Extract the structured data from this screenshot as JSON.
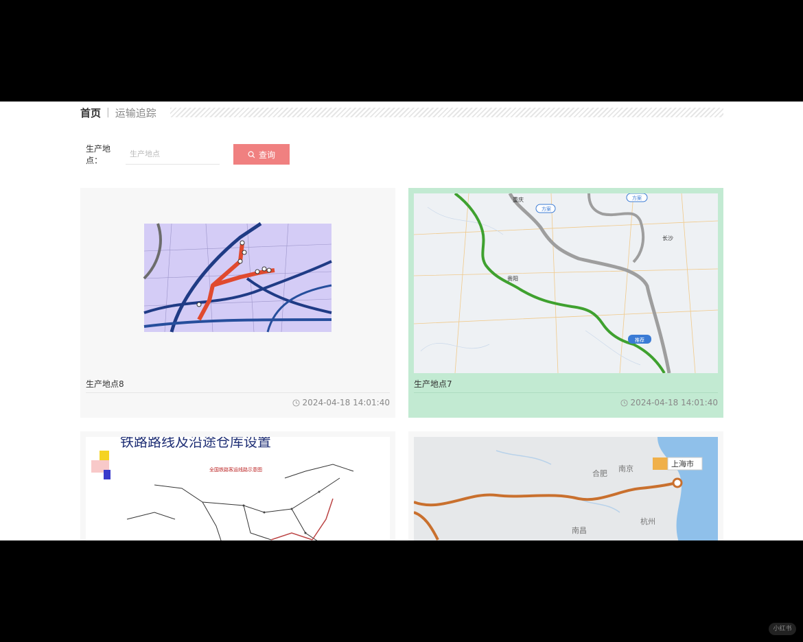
{
  "breadcrumb": {
    "home": "首页",
    "separator": "|",
    "current": "运输追踪"
  },
  "search": {
    "label": "生产地点：",
    "placeholder": "生产地点",
    "value": "",
    "button_label": "查询"
  },
  "cards": [
    {
      "title": "生产地点8",
      "time": "2024-04-18 14:01:40",
      "map": "city-route-map"
    },
    {
      "title": "生产地点7",
      "time": "2024-04-18 14:01:40",
      "map": "regional-road-map",
      "labels": [
        "重庆",
        "方案",
        "方案",
        "长沙",
        "贵阳",
        "推荐"
      ]
    },
    {
      "title": "",
      "time": "",
      "map": "railway-network-map",
      "labels": [
        "铁路路线及沿途仓库设置",
        "全国铁路客运线路示意图"
      ]
    },
    {
      "title": "",
      "time": "",
      "map": "east-china-route-map",
      "labels": [
        "上海市",
        "合肥",
        "南京",
        "杭州",
        "南昌"
      ]
    }
  ],
  "colors": {
    "accent_button": "#f08080",
    "selected_card": "#c2ead2",
    "route_green": "#3fa12f",
    "route_red": "#e04a2f",
    "route_orange": "#c9702e"
  },
  "icons": {
    "search": "search-icon",
    "clock": "clock-icon"
  },
  "watermark": "小红书"
}
